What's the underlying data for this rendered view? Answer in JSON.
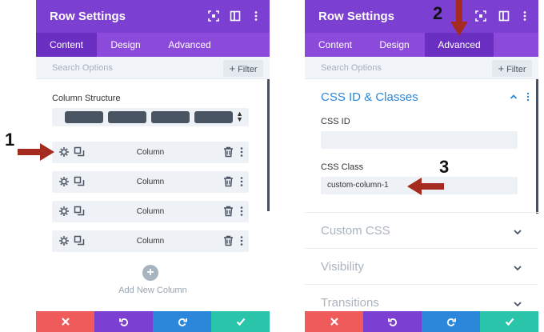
{
  "left_panel": {
    "title": "Row Settings",
    "tabs": [
      "Content",
      "Design",
      "Advanced"
    ],
    "active_tab": "Content",
    "search_placeholder": "Search Options",
    "filter_label": "Filter",
    "column_structure_label": "Column Structure",
    "columns": [
      {
        "label": "Column"
      },
      {
        "label": "Column"
      },
      {
        "label": "Column"
      },
      {
        "label": "Column"
      }
    ],
    "add_column_label": "Add New Column"
  },
  "right_panel": {
    "title": "Row Settings",
    "tabs": [
      "Content",
      "Design",
      "Advanced"
    ],
    "active_tab": "Advanced",
    "search_placeholder": "Search Options",
    "filter_label": "Filter",
    "section_open": "CSS ID & Classes",
    "css_id_label": "CSS ID",
    "css_id_value": "",
    "css_class_label": "CSS Class",
    "css_class_value": "custom-column-1",
    "sections_collapsed": [
      "Custom CSS",
      "Visibility",
      "Transitions"
    ]
  },
  "annotations": {
    "step1": "1",
    "step2": "2",
    "step3": "3"
  },
  "colors": {
    "header_purple": "#7b3fd1",
    "tab_purple": "#8b4ad9",
    "active_tab": "#6a2fc0",
    "cancel_red": "#ef5b5b",
    "undo_purple": "#7b3fd1",
    "redo_blue": "#2b87da",
    "save_green": "#29c4a9",
    "accent_blue": "#2b87da",
    "arrow_red": "#a52b1f"
  },
  "footer_icons": [
    "close-icon",
    "undo-icon",
    "redo-icon",
    "check-icon"
  ]
}
